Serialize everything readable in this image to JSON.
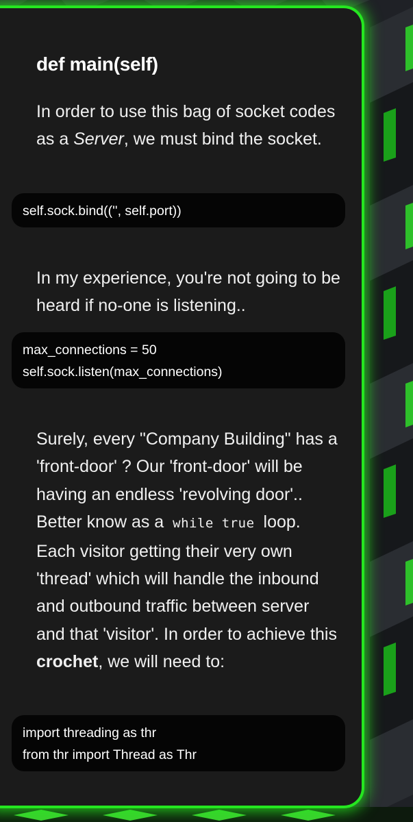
{
  "section": {
    "heading": "def main(self)",
    "intro": {
      "before": "In order to use this bag of socket codes as a ",
      "em": "Server",
      "after": ", we must bind the socket."
    },
    "code_bind": [
      "self.sock.bind(('', self.port))"
    ],
    "listen_text": "In my experience, you're not going to be heard if no-one is listening..",
    "code_listen": [
      "max_connections = 50",
      "self.sock.listen(max_connections)"
    ],
    "front_door": {
      "part1": "Surely, every \"Company Building\" has a 'front-door' ? Our 'front-door' will be having an endless 'revolving door'.. Better know as a",
      "inline_code": "while true",
      "part2": "loop. Each visitor getting their very own 'thread' which will handle the inbound and outbound traffic between server and that 'visitor'. In order to achieve this",
      "strong": "crochet",
      "part3": ", we will need to:"
    },
    "code_threading": [
      "import threading as thr",
      "from thr import Thread as Thr"
    ]
  },
  "colors": {
    "card_bg": "#1b1b1b",
    "glow": "#25e620",
    "code_bg": "#050505",
    "gradient": [
      "#2ab8b6",
      "#c345c8"
    ]
  }
}
